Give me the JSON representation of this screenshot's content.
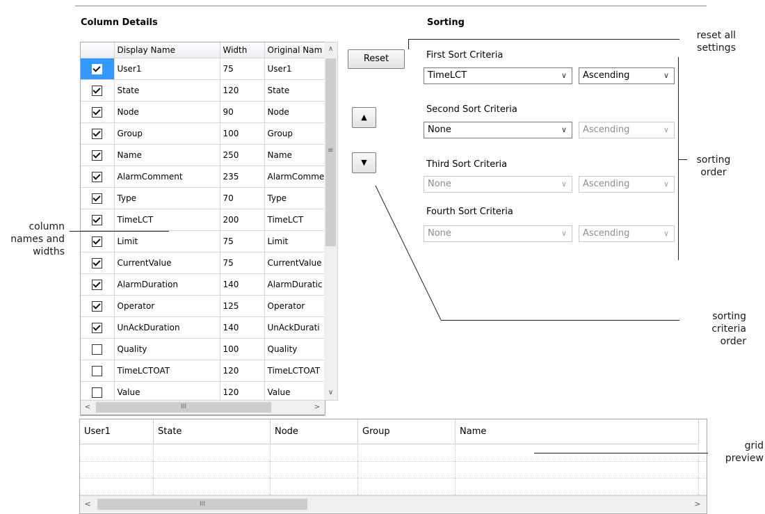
{
  "column_details": {
    "title": "Column Details",
    "headers": [
      "",
      "Display Name",
      "Width",
      "Original Nam"
    ],
    "rows": [
      {
        "checked": true,
        "display_name": "User1",
        "width": "75",
        "original_name": "User1"
      },
      {
        "checked": true,
        "display_name": "State",
        "width": "120",
        "original_name": "State"
      },
      {
        "checked": true,
        "display_name": "Node",
        "width": "90",
        "original_name": "Node"
      },
      {
        "checked": true,
        "display_name": "Group",
        "width": "100",
        "original_name": "Group"
      },
      {
        "checked": true,
        "display_name": "Name",
        "width": "250",
        "original_name": "Name"
      },
      {
        "checked": true,
        "display_name": "AlarmComment",
        "width": "235",
        "original_name": "AlarmComme"
      },
      {
        "checked": true,
        "display_name": "Type",
        "width": "70",
        "original_name": "Type"
      },
      {
        "checked": true,
        "display_name": "TimeLCT",
        "width": "200",
        "original_name": "TimeLCT"
      },
      {
        "checked": true,
        "display_name": "Limit",
        "width": "75",
        "original_name": "Limit"
      },
      {
        "checked": true,
        "display_name": "CurrentValue",
        "width": "75",
        "original_name": "CurrentValue"
      },
      {
        "checked": true,
        "display_name": "AlarmDuration",
        "width": "140",
        "original_name": "AlarmDuratic"
      },
      {
        "checked": true,
        "display_name": "Operator",
        "width": "125",
        "original_name": "Operator"
      },
      {
        "checked": true,
        "display_name": "UnAckDuration",
        "width": "140",
        "original_name": "UnAckDurati"
      },
      {
        "checked": false,
        "display_name": "Quality",
        "width": "100",
        "original_name": "Quality"
      },
      {
        "checked": false,
        "display_name": "TimeLCTOAT",
        "width": "120",
        "original_name": "TimeLCTOAT"
      },
      {
        "checked": false,
        "display_name": "Value",
        "width": "120",
        "original_name": "Value"
      }
    ],
    "scroll_grip": "III"
  },
  "buttons": {
    "reset_label": "Reset",
    "move_up_glyph": "▲",
    "move_down_glyph": "▼"
  },
  "sorting": {
    "title": "Sorting",
    "criteria": [
      {
        "label": "First Sort Criteria",
        "field": "TimeLCT",
        "order": "Ascending",
        "field_enabled": true,
        "order_enabled": true
      },
      {
        "label": "Second Sort Criteria",
        "field": "None",
        "order": "Ascending",
        "field_enabled": true,
        "order_enabled": false
      },
      {
        "label": "Third Sort Criteria",
        "field": "None",
        "order": "Ascending",
        "field_enabled": false,
        "order_enabled": false
      },
      {
        "label": "Fourth Sort Criteria",
        "field": "None",
        "order": "Ascending",
        "field_enabled": false,
        "order_enabled": false
      }
    ]
  },
  "preview": {
    "headers": [
      "User1",
      "State",
      "Node",
      "Group",
      "Name"
    ],
    "scroll_grip": "III"
  },
  "annotations": {
    "reset": [
      "reset all",
      "settings"
    ],
    "sorting_order": [
      "sorting",
      "order"
    ],
    "column_names": [
      "column",
      "names and",
      "widths"
    ],
    "sorting_criteria_order": [
      "sorting",
      "criteria",
      "order"
    ],
    "grid_preview": [
      "grid",
      "preview"
    ]
  },
  "colors": {
    "selection": "#3399ff",
    "border": "#a8a8a8",
    "annotation_line": "#222222"
  }
}
